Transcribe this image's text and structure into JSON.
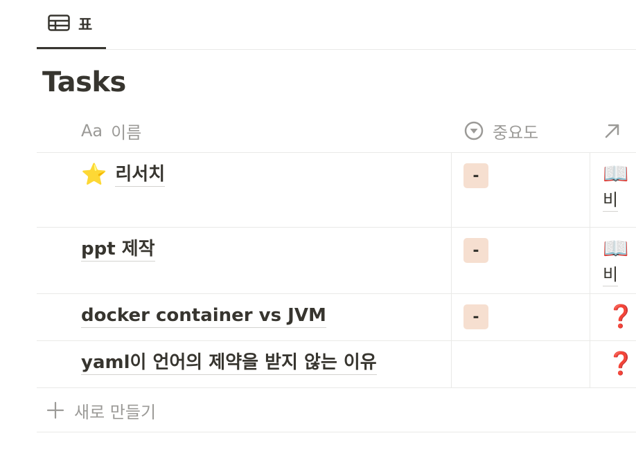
{
  "tab": {
    "label": "표",
    "icon": "table-icon"
  },
  "title": "Tasks",
  "columns": [
    {
      "label": "이름",
      "icon_text": "Aa",
      "icon": "text-type-icon"
    },
    {
      "label": "중요도",
      "icon": "select-icon"
    },
    {
      "label": "",
      "icon": "relation-arrow-icon"
    }
  ],
  "rows": [
    {
      "emoji": "⭐",
      "name": "리서치",
      "importance": "-",
      "relation_emoji": "📖",
      "relation_text": "비"
    },
    {
      "emoji": "",
      "name": "ppt 제작",
      "importance": "-",
      "relation_emoji": "📖",
      "relation_text": "비"
    },
    {
      "emoji": "",
      "name": "docker container vs JVM",
      "importance": "-",
      "relation_emoji": "❓",
      "relation_text": ""
    },
    {
      "emoji": "",
      "name": "yaml이 언어의 제약을 받지 않는 이유",
      "importance": "",
      "relation_emoji": "❓",
      "relation_text": ""
    }
  ],
  "new_row": {
    "label": "새로 만들기",
    "icon": "plus-icon"
  },
  "colors": {
    "tag_background": "#f6dfd0",
    "text": "#37352f",
    "muted": "#9b9a97",
    "question_red": "#e03e3e"
  }
}
